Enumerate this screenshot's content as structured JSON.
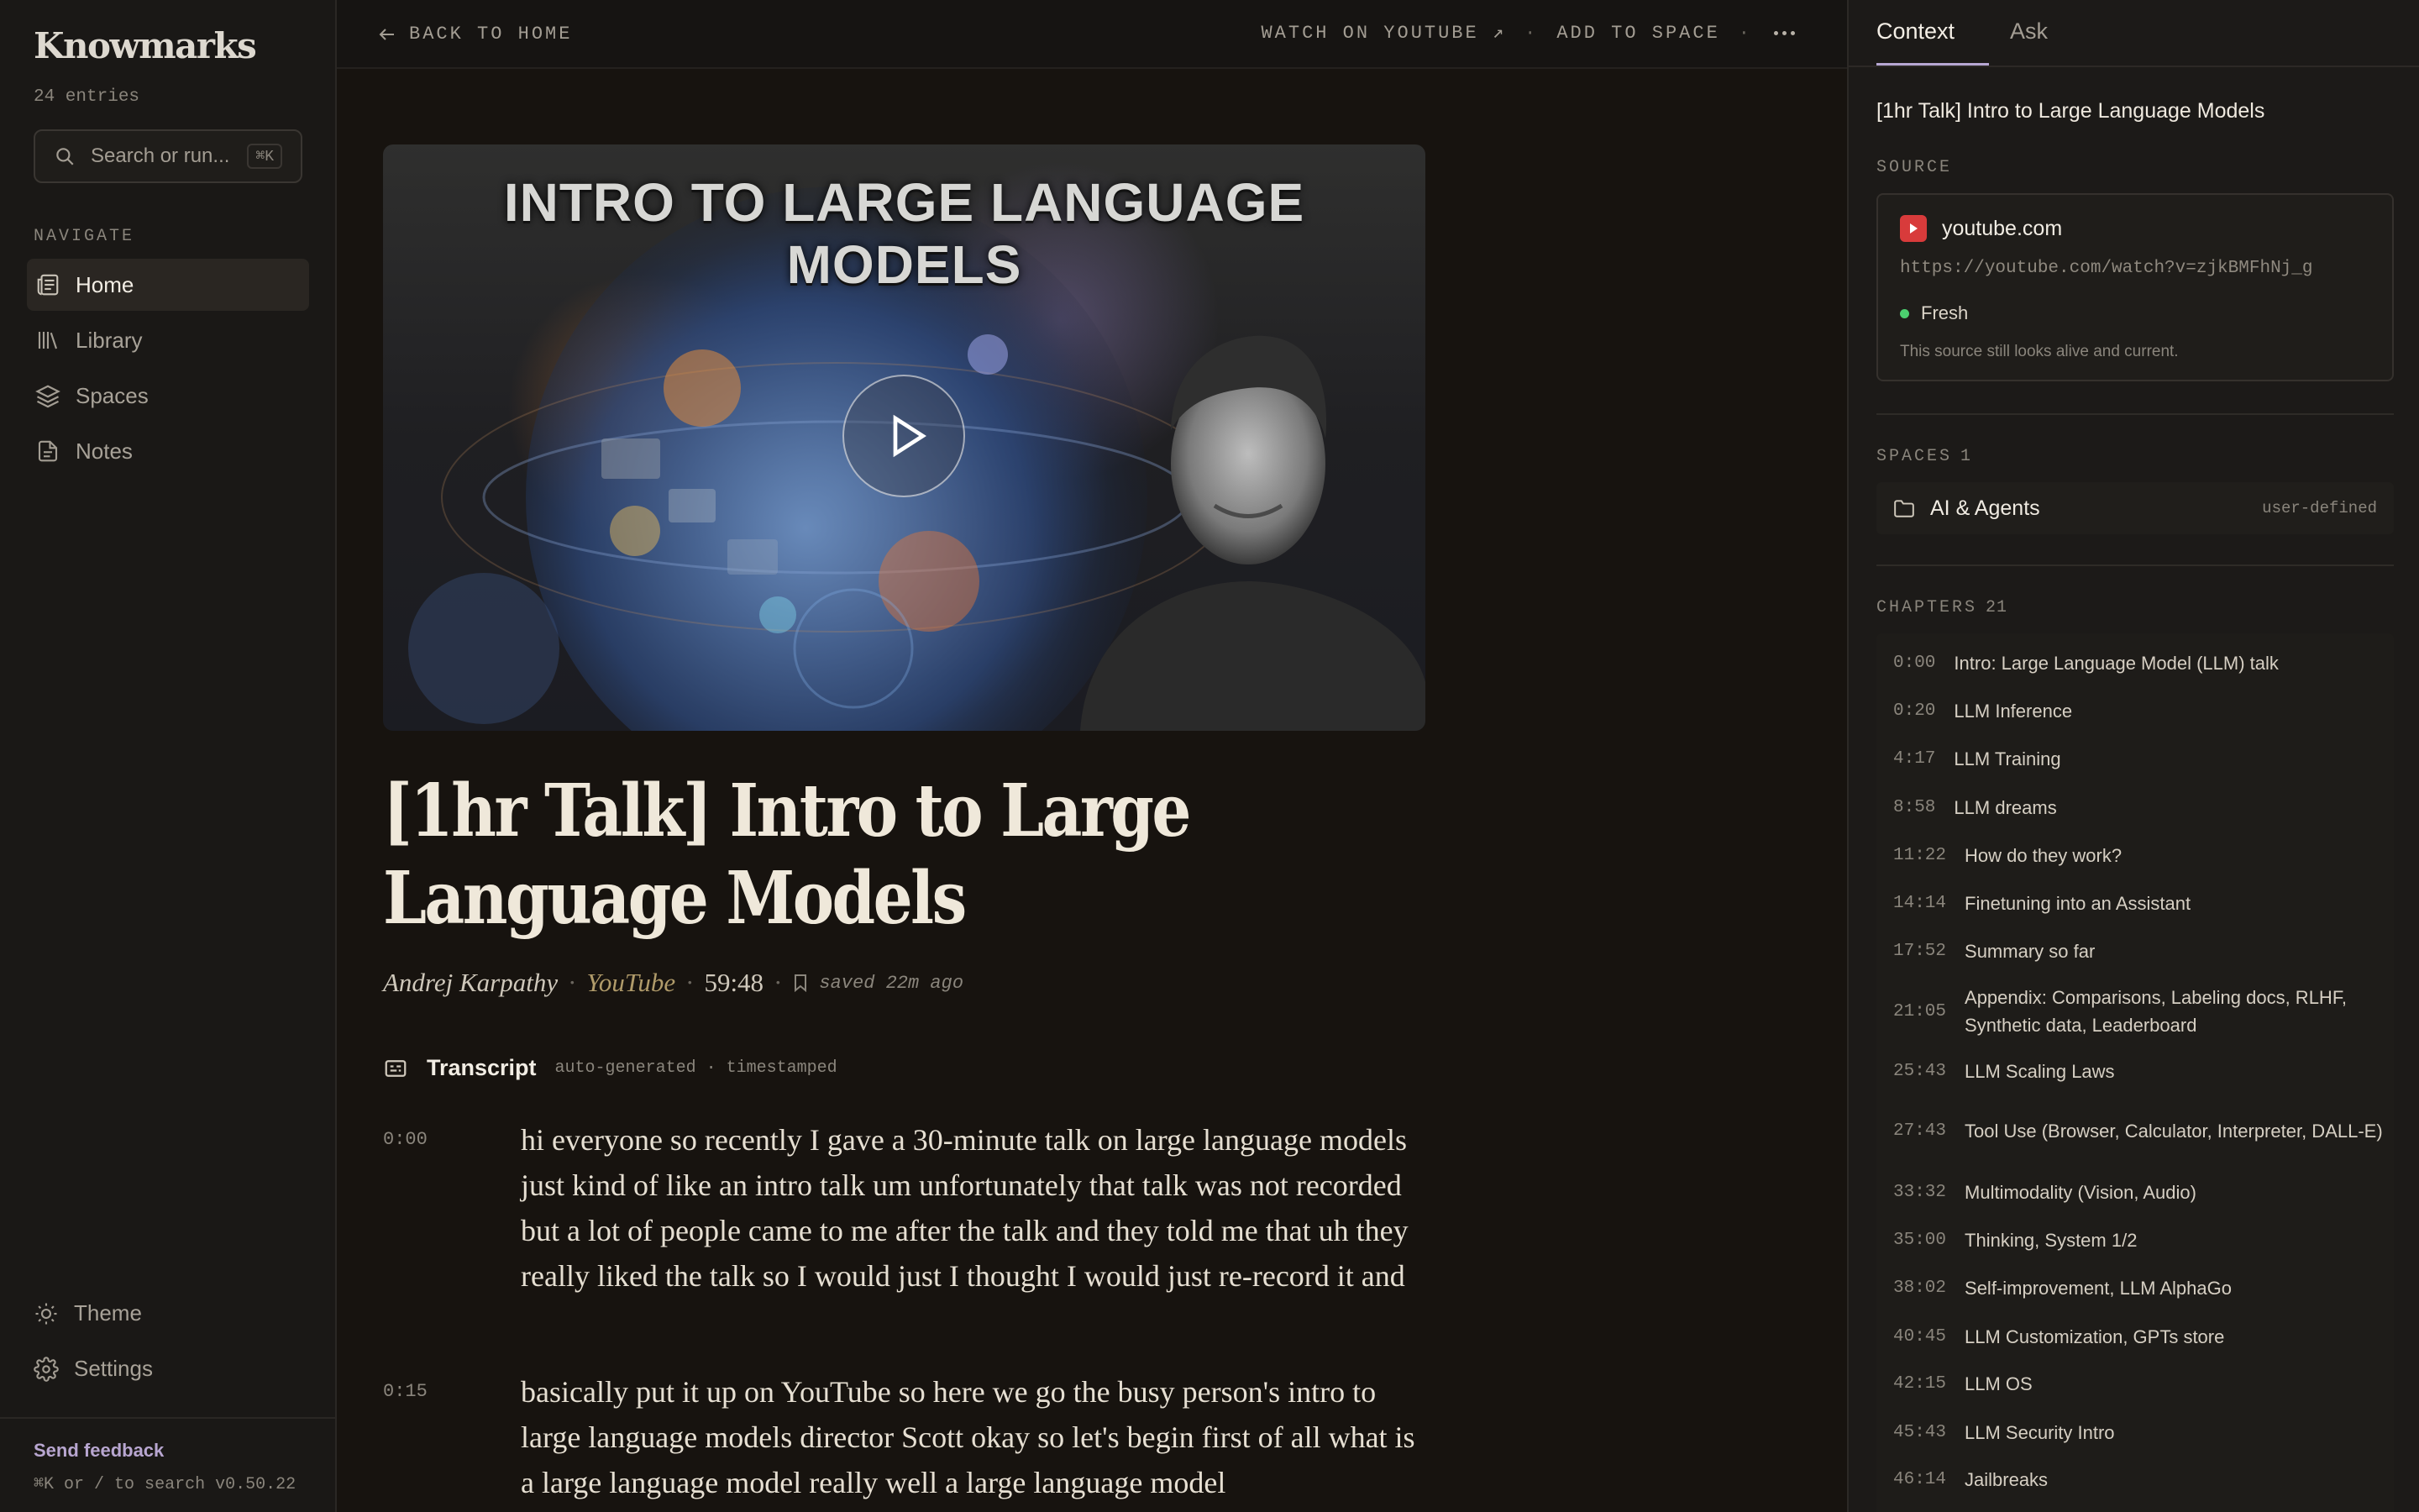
{
  "sidebar": {
    "logo": "Knowmarks",
    "entries": "24 entries",
    "search_placeholder": "Search or run...",
    "search_shortcut": "⌘K",
    "nav_heading": "NAVIGATE",
    "nav_items": [
      {
        "label": "Home",
        "icon": "newspaper-icon",
        "active": true
      },
      {
        "label": "Library",
        "icon": "library-icon",
        "active": false
      },
      {
        "label": "Spaces",
        "icon": "layers-icon",
        "active": false
      },
      {
        "label": "Notes",
        "icon": "note-icon",
        "active": false
      }
    ],
    "theme_label": "Theme",
    "settings_label": "Settings",
    "feedback_label": "Send feedback",
    "hint": "⌘K or / to search  v0.50.22"
  },
  "topbar": {
    "back_label": "BACK TO HOME",
    "watch_label": "WATCH ON YOUTUBE ↗",
    "add_label": "ADD TO SPACE",
    "sep": "·"
  },
  "video": {
    "thumbnail_title": "INTRO TO LARGE LANGUAGE MODELS"
  },
  "doc": {
    "title": "[1hr Talk] Intro to Large Language Models",
    "author": "Andrej Karpathy",
    "platform": "YouTube",
    "duration": "59:48",
    "saved": "saved 22m ago",
    "dot": "·"
  },
  "transcript": {
    "title": "Transcript",
    "subtitle": "auto-generated · timestamped",
    "segments": [
      {
        "time": "0:00",
        "text": "hi everyone so recently I gave a 30-minute talk on large language models just kind of like an intro talk um unfortunately that talk was not recorded but a lot of people came to me after the talk and they told me that uh they really liked the talk so I would just I thought I would just re-record it and"
      },
      {
        "time": "0:15",
        "text": "basically put it up on YouTube so here we go the busy person's intro to large language models director Scott okay so let's begin first of all what is a large language model really well a large language model"
      }
    ]
  },
  "panel": {
    "tabs": [
      "Context",
      "Ask"
    ],
    "title": "[1hr Talk] Intro to Large Language Models",
    "source_label": "SOURCE",
    "source": {
      "domain": "youtube.com",
      "url": "https://youtube.com/watch?v=zjkBMFhNj_g",
      "status": "Fresh",
      "status_color": "#4ccf6f",
      "note": "This source still looks alive and current."
    },
    "spaces_label": "SPACES",
    "spaces_count": "1",
    "spaces": [
      {
        "name": "AI & Agents",
        "tag": "user-defined"
      }
    ],
    "chapters_label": "CHAPTERS",
    "chapters_count": "21",
    "chapters": [
      {
        "time": "0:00",
        "title": "Intro: Large Language Model (LLM) talk"
      },
      {
        "time": "0:20",
        "title": "LLM Inference"
      },
      {
        "time": "4:17",
        "title": "LLM Training"
      },
      {
        "time": "8:58",
        "title": "LLM dreams"
      },
      {
        "time": "11:22",
        "title": "How do they work?"
      },
      {
        "time": "14:14",
        "title": "Finetuning into an Assistant"
      },
      {
        "time": "17:52",
        "title": "Summary so far"
      },
      {
        "time": "21:05",
        "title": "Appendix: Comparisons, Labeling docs, RLHF, Synthetic data, Leaderboard"
      },
      {
        "time": "25:43",
        "title": "LLM Scaling Laws"
      },
      {
        "time": "27:43",
        "title": "Tool Use (Browser, Calculator, Interpreter, DALL-E)"
      },
      {
        "time": "33:32",
        "title": "Multimodality (Vision, Audio)"
      },
      {
        "time": "35:00",
        "title": "Thinking, System 1/2"
      },
      {
        "time": "38:02",
        "title": "Self-improvement, LLM AlphaGo"
      },
      {
        "time": "40:45",
        "title": "LLM Customization, GPTs store"
      },
      {
        "time": "42:15",
        "title": "LLM OS"
      },
      {
        "time": "45:43",
        "title": "LLM Security Intro"
      },
      {
        "time": "46:14",
        "title": "Jailbreaks"
      }
    ]
  },
  "colors": {
    "background": "#17130f",
    "accent": "#b7a7d3",
    "youtube_red": "#d83b3b",
    "platform_gold": "#b09b6a"
  }
}
